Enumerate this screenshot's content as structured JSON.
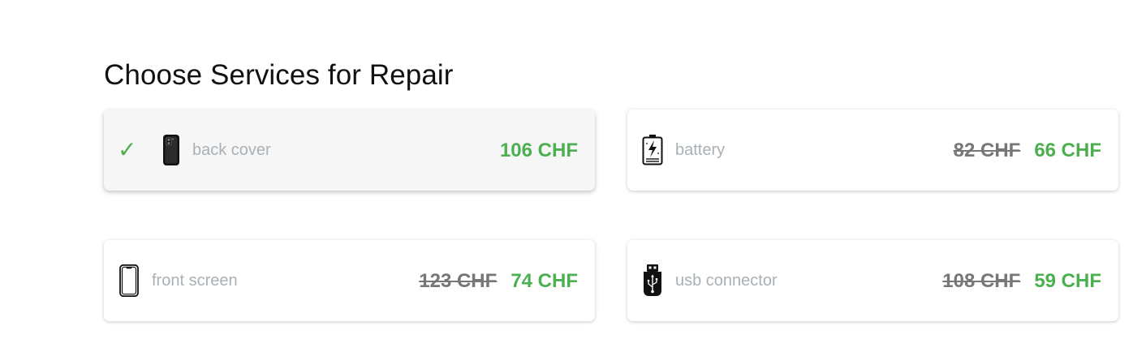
{
  "heading": "Choose Services for Repair",
  "colors": {
    "accent": "#4caf50",
    "old_price": "#777777",
    "label": "#a9b1b6",
    "selected_bg": "#f6f6f6"
  },
  "services": [
    {
      "label": "back cover",
      "icon": "phone-back-icon",
      "selected": true,
      "check": "✓",
      "old_price": "",
      "price": "106 CHF"
    },
    {
      "label": "battery",
      "icon": "battery-icon",
      "selected": false,
      "old_price": "82 CHF",
      "price": "66 CHF"
    },
    {
      "label": "front screen",
      "icon": "phone-front-icon",
      "selected": false,
      "old_price": "123 CHF",
      "price": "74 CHF"
    },
    {
      "label": "usb connector",
      "icon": "usb-icon",
      "selected": false,
      "old_price": "108 CHF",
      "price": "59 CHF"
    }
  ]
}
